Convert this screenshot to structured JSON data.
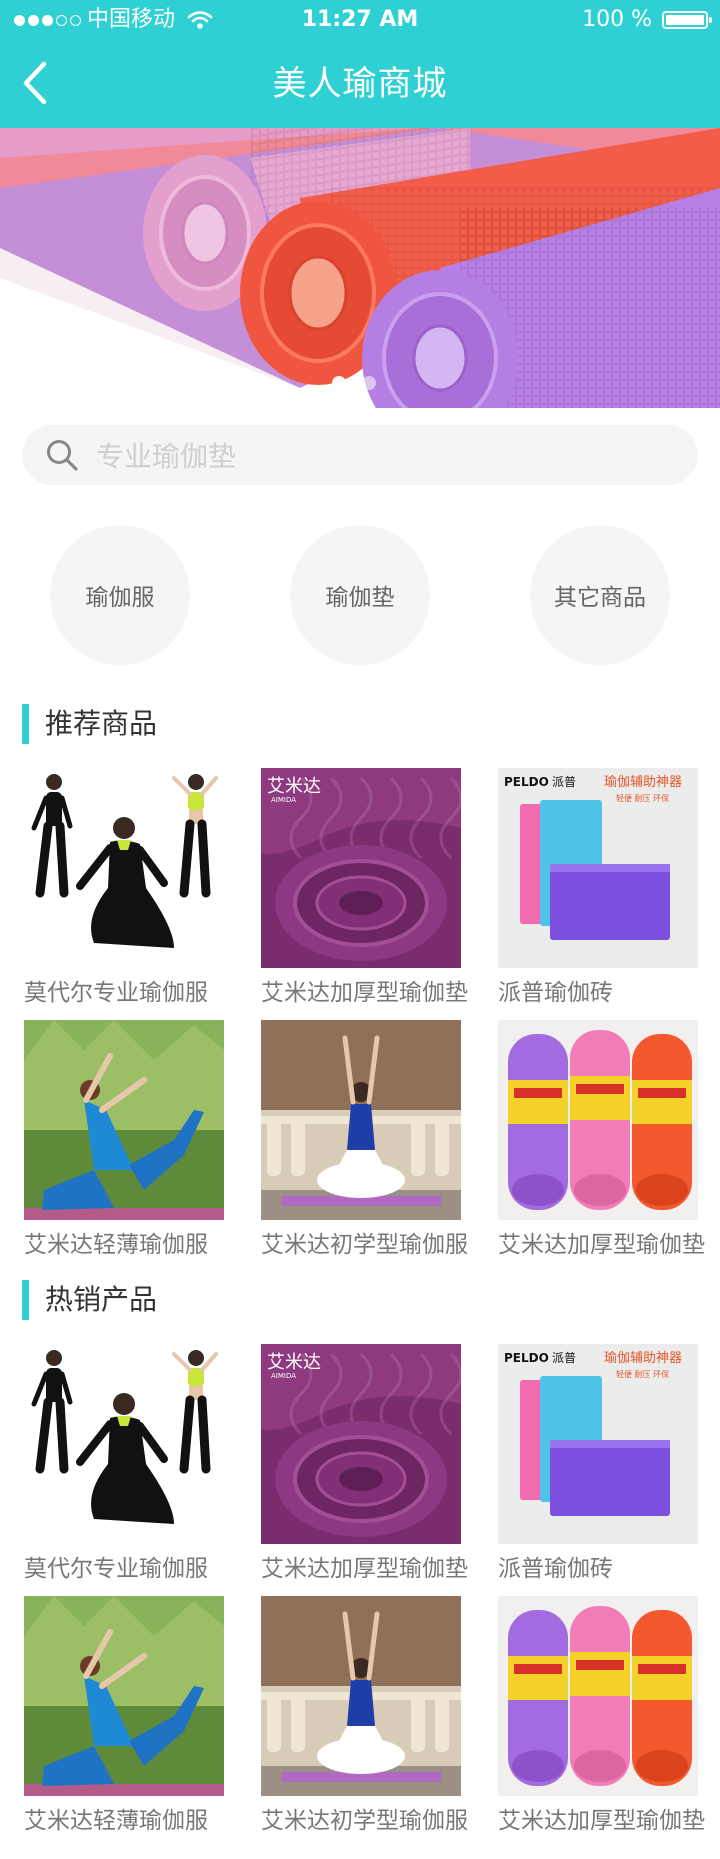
{
  "status_bar": {
    "carrier": "中国移动",
    "time": "11:27 AM",
    "battery": "100 %"
  },
  "header": {
    "title": "美人瑜商城",
    "back_icon": "chevron-left-icon"
  },
  "banner": {
    "page_count": 2,
    "active_page": 1
  },
  "search": {
    "placeholder": "专业瑜伽垫",
    "value": "",
    "icon": "search-icon"
  },
  "categories": [
    {
      "label": "瑜伽服"
    },
    {
      "label": "瑜伽垫"
    },
    {
      "label": "其它商品"
    }
  ],
  "sections": [
    {
      "title": "推荐商品",
      "products": [
        {
          "name": "莫代尔专业瑜伽服"
        },
        {
          "name": "艾米达加厚型瑜伽垫"
        },
        {
          "name": "派普瑜伽砖"
        },
        {
          "name": "艾米达轻薄瑜伽服"
        },
        {
          "name": "艾米达初学型瑜伽服"
        },
        {
          "name": "艾米达加厚型瑜伽垫"
        }
      ]
    },
    {
      "title": "热销产品",
      "products": [
        {
          "name": "莫代尔专业瑜伽服"
        },
        {
          "name": "艾米达加厚型瑜伽垫"
        },
        {
          "name": "派普瑜伽砖"
        },
        {
          "name": "艾米达轻薄瑜伽服"
        },
        {
          "name": "艾米达初学型瑜伽服"
        },
        {
          "name": "艾米达加厚型瑜伽垫"
        }
      ]
    }
  ],
  "product_image_text": {
    "mat_brand": "艾米达",
    "mat_brand_en": "AIMIDA",
    "block_brand": "PELDO",
    "block_brand_cn": "派普",
    "block_slogan": "瑜伽辅助神器",
    "block_sub": "轻便 耐压 环保"
  },
  "colors": {
    "accent": "#2fd0d3",
    "background": "#ffffff",
    "search_bg": "#f5f5f5",
    "text_muted": "#777777"
  }
}
